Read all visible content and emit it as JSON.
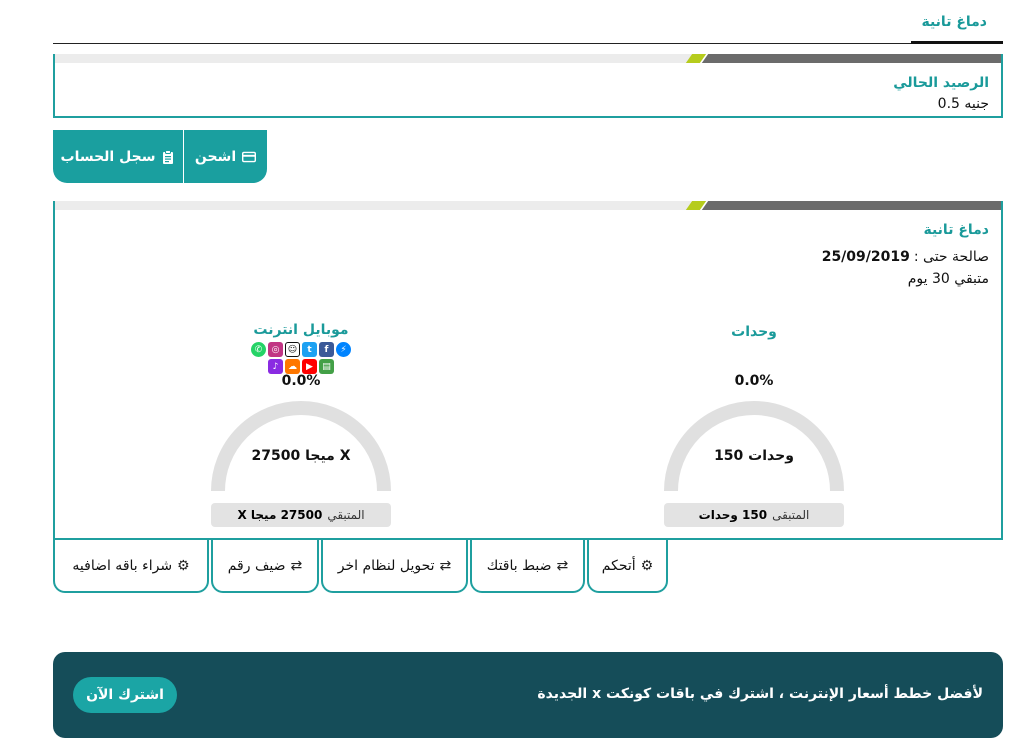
{
  "tabs": {
    "active_label": "دماغ تانية"
  },
  "balance": {
    "title": "الرصيد الحالي",
    "value": "0.5 جنيه"
  },
  "account_actions": {
    "history_label": "سجل الحساب",
    "history_icon": "clipboard-icon",
    "recharge_label": "اشحن",
    "recharge_icon": "credit-card-icon"
  },
  "package": {
    "title": "دماغ تانية",
    "valid_until_label": "صالحة حتى :",
    "valid_until_date": "25/09/2019",
    "remaining_days": "متبقي 30 يوم",
    "units": {
      "title": "وحدات",
      "percent": "0.0%",
      "usage_fraction": 0.0,
      "center_value": "150 وحدات",
      "remaining_label": "المتبقى",
      "remaining_value": "150 وحدات"
    },
    "internet": {
      "title": "موبايل انترنت",
      "percent": "0.0%",
      "usage_fraction": 0.0,
      "center_value": "27500 ميجا X",
      "remaining_label": "المتبقي",
      "remaining_value": "27500 ميجا X",
      "apps": [
        "whatsapp-icon",
        "instagram-icon",
        "snapchat-icon",
        "twitter-icon",
        "facebook-icon",
        "messenger-icon",
        "anghami-icon",
        "soundcloud-icon",
        "youtube-icon",
        "tgram-icon"
      ]
    }
  },
  "package_actions": [
    {
      "label": "أتحكم",
      "icon": "gear-icon"
    },
    {
      "label": "ضبط باقتك",
      "icon": "swap-arrows-icon"
    },
    {
      "label": "تحويل لنظام اخر",
      "icon": "swap-arrows-icon"
    },
    {
      "label": "ضيف رقم",
      "icon": "swap-arrows-icon"
    },
    {
      "label": "شراء باقه اضافيه",
      "icon": "gear-icon"
    }
  ],
  "promo": {
    "text": "لأفضل خطط أسعار الإنترنت ، اشترك في باقات كونكت x الجديدة",
    "button_label": "اشترك الآن"
  },
  "colors": {
    "teal": "#1a9f9f",
    "dark_teal": "#154d59",
    "gauge_track": "#e0e0e0",
    "lime_accent": "#b6cc1d"
  }
}
